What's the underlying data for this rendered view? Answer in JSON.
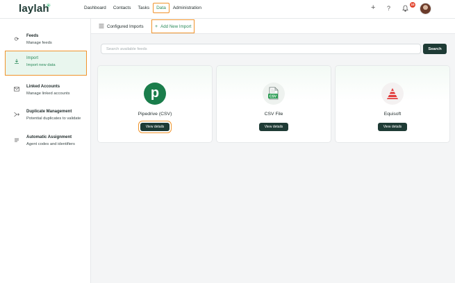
{
  "app": {
    "logo": "laylah",
    "logo_mark": "✳"
  },
  "nav": [
    {
      "label": "Dashboard"
    },
    {
      "label": "Contacts"
    },
    {
      "label": "Tasks"
    },
    {
      "label": "Data",
      "active": true
    },
    {
      "label": "Administration"
    }
  ],
  "header": {
    "notification_count": "10",
    "icons": [
      "plus-icon",
      "help-icon",
      "bell-icon"
    ]
  },
  "sidebar": {
    "items": [
      {
        "title": "Feeds",
        "subtitle": "Manage feeds",
        "icon": "sync-icon"
      },
      {
        "title": "Import",
        "subtitle": "Import new data",
        "icon": "upload-icon",
        "active": true
      },
      {
        "title": "Linked Accounts",
        "subtitle": "Manage linked accounts",
        "icon": "mail-icon"
      },
      {
        "title": "Duplicate Management",
        "subtitle": "Potential duplicates to validate",
        "icon": "merge-icon"
      },
      {
        "title": "Automatic Assignment",
        "subtitle": "Agent codes and identifiers",
        "icon": "list-icon"
      }
    ]
  },
  "tabs": {
    "configured_label": "Configured Imports",
    "add_label": "Add New Import"
  },
  "search": {
    "placeholder": "Search available feeds",
    "button_label": "Search"
  },
  "cards": [
    {
      "name": "Pipedrive (CSV)",
      "button": "View details",
      "logo_text": "p",
      "color": "#1a7d4b"
    },
    {
      "name": "CSV File",
      "button": "View details",
      "logo_text": "CSV",
      "color": "#2e9e56"
    },
    {
      "name": "Equisoft",
      "button": "View details",
      "color": "#e23b3b"
    }
  ],
  "colors": {
    "primary": "#1e3b35",
    "accent": "#2a8a5a",
    "highlight": "#f0932b"
  }
}
